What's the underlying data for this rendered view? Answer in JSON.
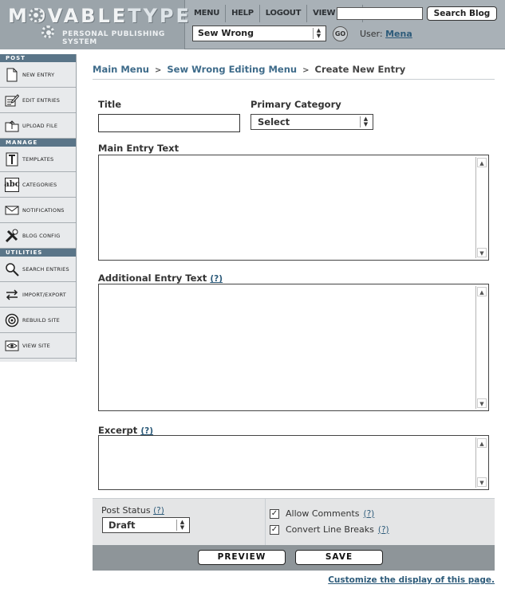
{
  "header": {
    "logo_main": "MOVABLETYPE",
    "logo_subtitle": "PERSONAL PUBLISHING SYSTEM",
    "nav": [
      "MENU",
      "HELP",
      "LOGOUT",
      "VIEW SITE"
    ],
    "search_placeholder": "",
    "search_button": "Search Blog",
    "blog_selected": "Sew Wrong",
    "go_button": "GO",
    "user_label": "User:",
    "user_name": "Mena"
  },
  "sidebar": {
    "sections": [
      {
        "heading": "POST",
        "items": [
          {
            "label": "NEW ENTRY",
            "icon": "new-entry-icon"
          },
          {
            "label": "EDIT ENTRIES",
            "icon": "edit-entries-icon"
          },
          {
            "label": "UPLOAD FILE",
            "icon": "upload-file-icon"
          }
        ]
      },
      {
        "heading": "MANAGE",
        "items": [
          {
            "label": "TEMPLATES",
            "icon": "templates-icon"
          },
          {
            "label": "CATEGORIES",
            "icon": "categories-icon"
          },
          {
            "label": "NOTIFICATIONS",
            "icon": "notifications-icon"
          },
          {
            "label": "BLOG CONFIG",
            "icon": "blog-config-icon"
          }
        ]
      },
      {
        "heading": "UTILITIES",
        "items": [
          {
            "label": "SEARCH ENTRIES",
            "icon": "search-entries-icon"
          },
          {
            "label": "IMPORT/EXPORT",
            "icon": "import-export-icon"
          },
          {
            "label": "REBUILD SITE",
            "icon": "rebuild-site-icon"
          },
          {
            "label": "VIEW SITE",
            "icon": "view-site-icon"
          }
        ]
      }
    ]
  },
  "breadcrumb": {
    "items": [
      "Main Menu",
      "Sew Wrong Editing Menu",
      "Create New Entry"
    ],
    "separator": ">"
  },
  "form": {
    "title_label": "Title",
    "title_value": "",
    "category_label": "Primary Category",
    "category_value": "Select",
    "main_text_label": "Main Entry Text",
    "main_text_value": "",
    "additional_text_label": "Additional Entry Text",
    "excerpt_label": "Excerpt",
    "help_marker": "(?)",
    "post_status_label": "Post Status",
    "post_status_value": "Draft",
    "allow_comments_label": "Allow Comments",
    "allow_comments_checked": true,
    "convert_breaks_label": "Convert Line Breaks",
    "convert_breaks_checked": true,
    "preview_button": "PREVIEW",
    "save_button": "SAVE"
  },
  "footer": {
    "customize_link": "Customize the display of this page."
  },
  "colors": {
    "header_bg": "#a9b1b7",
    "sidebar_heading_bg": "#5a7588",
    "link": "#2d5b7a",
    "action_bar_bg": "#8e9599"
  }
}
